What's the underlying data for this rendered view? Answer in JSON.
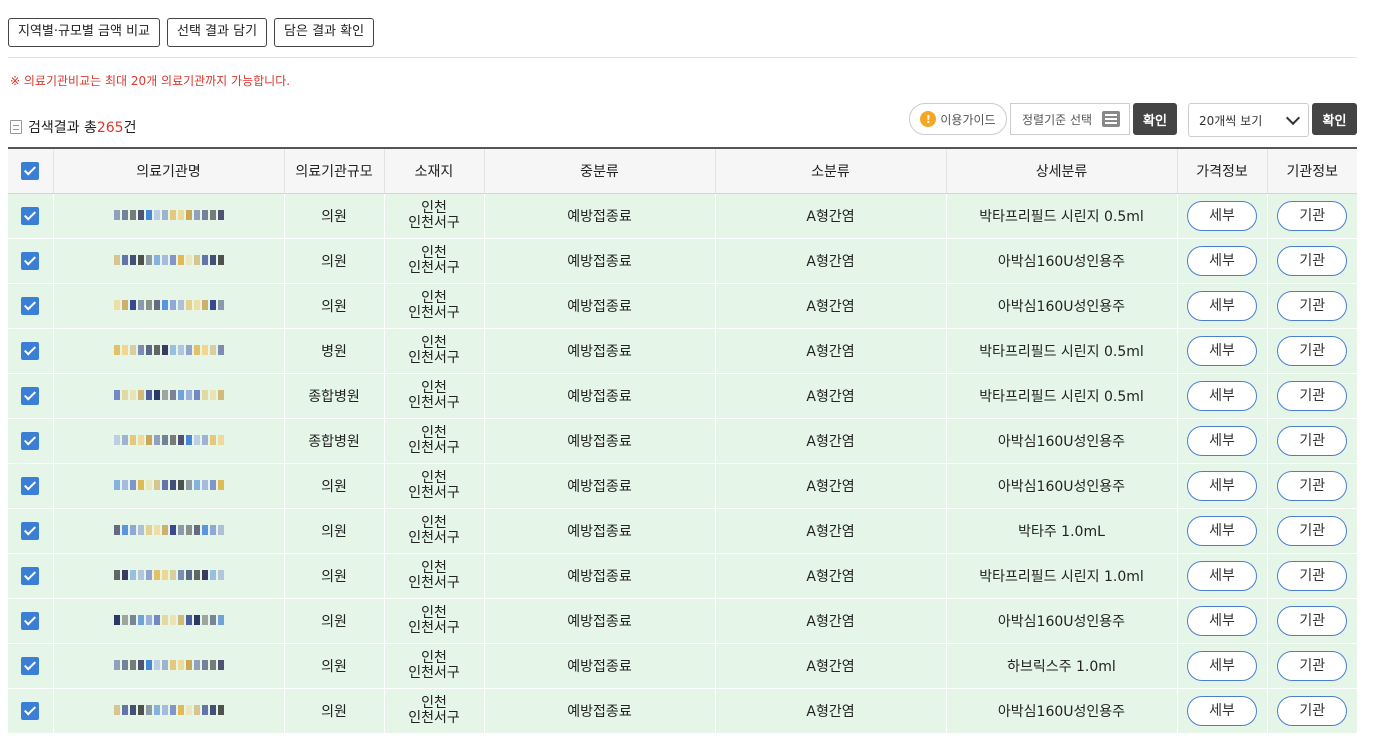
{
  "top_buttons": [
    "지역별·규모별 금액 비교",
    "선택 결과 담기",
    "담은 결과 확인"
  ],
  "notice": "※ 의료기관비교는 최대 20개 의료기관까지 가능합니다.",
  "result": {
    "prefix": "검색결과 총",
    "count": "265",
    "suffix": "건"
  },
  "controls": {
    "guide_label": "이용가이드",
    "sort_label": "정렬기준 선택",
    "confirm_label": "확인",
    "per_page_label": "20개씩 보기",
    "confirm2_label": "확인"
  },
  "table": {
    "headers": [
      "의료기관명",
      "의료기관규모",
      "소재지",
      "중분류",
      "소분류",
      "상세분류",
      "가격정보",
      "기관정보"
    ],
    "detail_btn": "세부",
    "org_btn": "기관",
    "rows": [
      {
        "size": "의원",
        "loc": "인천 인천서구",
        "mid": "예방접종료",
        "small": "A형간염",
        "detail": "박타프리필드 시린지 0.5ml"
      },
      {
        "size": "의원",
        "loc": "인천 인천서구",
        "mid": "예방접종료",
        "small": "A형간염",
        "detail": "아박심160U성인용주"
      },
      {
        "size": "의원",
        "loc": "인천 인천서구",
        "mid": "예방접종료",
        "small": "A형간염",
        "detail": "아박심160U성인용주"
      },
      {
        "size": "병원",
        "loc": "인천 인천서구",
        "mid": "예방접종료",
        "small": "A형간염",
        "detail": "박타프리필드 시린지 0.5ml"
      },
      {
        "size": "종합병원",
        "loc": "인천 인천서구",
        "mid": "예방접종료",
        "small": "A형간염",
        "detail": "박타프리필드 시린지 0.5ml"
      },
      {
        "size": "종합병원",
        "loc": "인천 인천서구",
        "mid": "예방접종료",
        "small": "A형간염",
        "detail": "아박심160U성인용주"
      },
      {
        "size": "의원",
        "loc": "인천 인천서구",
        "mid": "예방접종료",
        "small": "A형간염",
        "detail": "아박심160U성인용주"
      },
      {
        "size": "의원",
        "loc": "인천 인천서구",
        "mid": "예방접종료",
        "small": "A형간염",
        "detail": "박타주 1.0mL"
      },
      {
        "size": "의원",
        "loc": "인천 인천서구",
        "mid": "예방접종료",
        "small": "A형간염",
        "detail": "박타프리필드 시린지 1.0ml"
      },
      {
        "size": "의원",
        "loc": "인천 인천서구",
        "mid": "예방접종료",
        "small": "A형간염",
        "detail": "아박심160U성인용주"
      },
      {
        "size": "의원",
        "loc": "인천 인천서구",
        "mid": "예방접종료",
        "small": "A형간염",
        "detail": "하브릭스주 1.0ml"
      },
      {
        "size": "의원",
        "loc": "인천 인천서구",
        "mid": "예방접종료",
        "small": "A형간염",
        "detail": "아박심160U성인용주"
      }
    ]
  },
  "colors": {
    "accent": "#3a7fd5",
    "row_bg": "#e5f5e8",
    "notice": "#d9372d",
    "dark_button": "#444444"
  }
}
